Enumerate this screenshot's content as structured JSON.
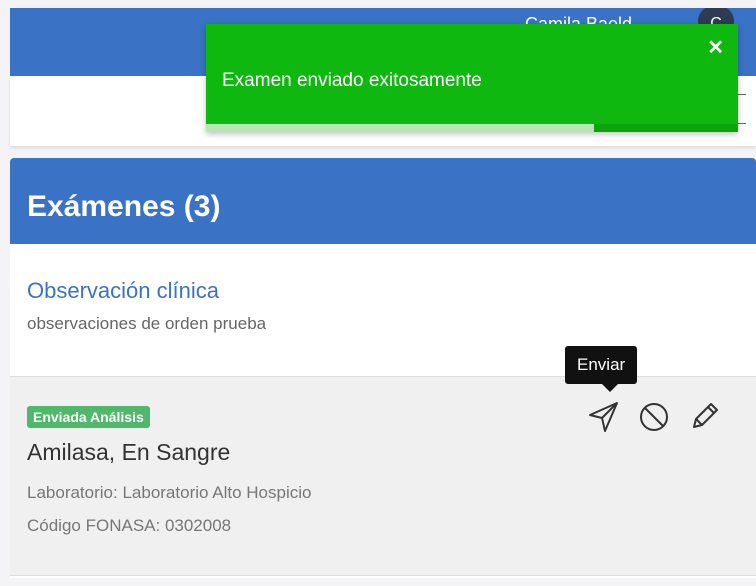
{
  "topbar": {
    "user_name": "Camila Baeld",
    "avatar_initial": "C"
  },
  "toast": {
    "message": "Examen enviado exitosamente",
    "close_symbol": "✕",
    "progress": 0.73,
    "color": "#0fb80f"
  },
  "card": {
    "header_title": "Exámenes (3)",
    "header_color": "#3a73c6"
  },
  "observation": {
    "title": "Observación clínica",
    "description": "observaciones de orden prueba"
  },
  "exam": {
    "status_badge": "Enviada Análisis",
    "name": "Amilasa, En Sangre",
    "laboratory": "Laboratorio: Laboratorio Alto Hospicio",
    "fonasa_code": "Código FONASA: 0302008",
    "actions": [
      "send-icon",
      "cancel-icon",
      "edit-icon"
    ]
  },
  "tooltip": {
    "text": "Enviar"
  }
}
